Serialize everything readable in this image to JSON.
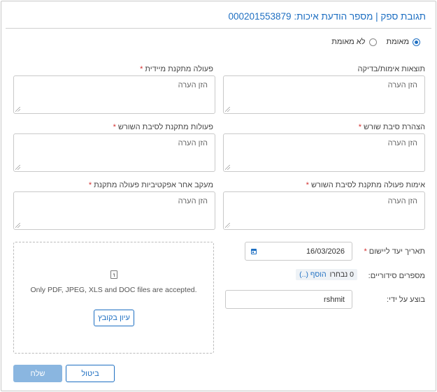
{
  "header": {
    "title": "תגובת ספק | מספר הודעת איכות: 000201553879"
  },
  "verification": {
    "options": [
      {
        "label": "מאומת",
        "selected": true
      },
      {
        "label": "לא מאומת",
        "selected": false
      }
    ]
  },
  "fields": {
    "verification_results": {
      "label": "תוצאות אימות/בדיקה",
      "required": false,
      "placeholder": "הזן הערה"
    },
    "immediate_corrective_action": {
      "label": "פעולה מתקנת מיידית",
      "required": true,
      "placeholder": "הזן הערה"
    },
    "root_cause_statement": {
      "label": "הצהרת סיבת שורש",
      "required": true,
      "placeholder": "הזן הערה"
    },
    "root_cause_corrective_actions": {
      "label": "פעולות מתקנת לסיבת השורש",
      "required": true,
      "placeholder": "הזן הערה"
    },
    "root_cause_corrective_verification": {
      "label": "אימות פעולה מתקנת לסיבת השורש",
      "required": true,
      "placeholder": "הזן הערה"
    },
    "effectiveness_followup": {
      "label": "מעקב אחר אפקטיביות פעולה מתקנת",
      "required": true,
      "placeholder": "הזן הערה"
    },
    "implementation_target_date": {
      "label": "תאריך יעד ליישום",
      "required": true,
      "value": "16/03/2026"
    },
    "serial_numbers": {
      "label": "מספרים סידוריים:",
      "count_text": "0 נבחרו",
      "add_text": "הוסף (..)"
    },
    "performed_by": {
      "label": "בוצע על ידי:",
      "value": "rshmit"
    }
  },
  "upload": {
    "accepted_text": "Only PDF, JPEG, XLS and DOC files are accepted.",
    "browse_label": "עיון בקובץ"
  },
  "footer": {
    "submit_label": "שלח",
    "cancel_label": "ביטול"
  },
  "colors": {
    "accent": "#1e6fc2",
    "required": "#d32f2f",
    "primary_disabled": "#8ab6e0"
  }
}
